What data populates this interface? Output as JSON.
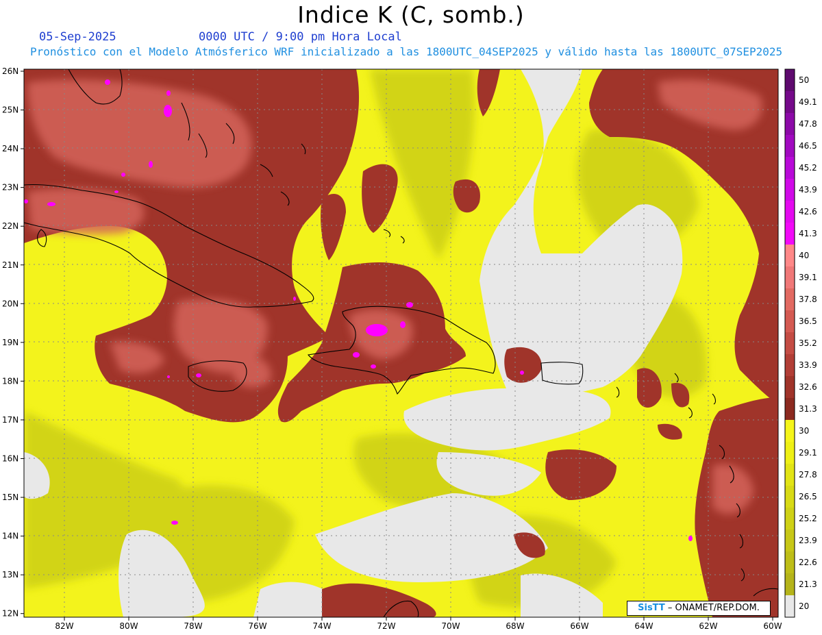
{
  "header": {
    "title": "Indice K (C, somb.)",
    "date": "05-Sep-2025",
    "time": "0000 UTC / 9:00 pm Hora Local",
    "forecast": "Pronóstico con el Modelo Atmósferico WRF inicializado a las 1800UTC_04SEP2025 y válido hasta las  1800UTC_07SEP2025"
  },
  "axes": {
    "lat_labels": [
      "26N",
      "25N",
      "24N",
      "23N",
      "22N",
      "21N",
      "20N",
      "19N",
      "18N",
      "17N",
      "16N",
      "15N",
      "14N",
      "13N",
      "12N"
    ],
    "lon_labels": [
      "82W",
      "80W",
      "78W",
      "76W",
      "74W",
      "72W",
      "70W",
      "68W",
      "66W",
      "64W",
      "62W",
      "60W"
    ]
  },
  "legend": {
    "levels": [
      "50",
      "49.1",
      "47.8",
      "46.5",
      "45.2",
      "43.9",
      "42.6",
      "41.3",
      "40",
      "39.1",
      "37.8",
      "36.5",
      "35.2",
      "33.9",
      "32.6",
      "31.3",
      "30",
      "29.1",
      "27.8",
      "26.5",
      "25.2",
      "23.9",
      "22.6",
      "21.3",
      "20"
    ],
    "colors": [
      "#5e0a6e",
      "#750a8a",
      "#8c0aa8",
      "#a10ac0",
      "#b80ad8",
      "#d00ae8",
      "#e40af0",
      "#f20af8",
      "#ff8888",
      "#f07878",
      "#e26a62",
      "#d45a52",
      "#c44c44",
      "#b23e36",
      "#a0342a",
      "#8c2a20",
      "#f5f51a",
      "#eef015",
      "#e2e415",
      "#d8da15",
      "#cfd116",
      "#c7c717",
      "#bebe18",
      "#b5b41a",
      "#e8e8e8"
    ]
  },
  "credit": {
    "logo": "SisTT",
    "text": " – ONAMET/REP.DOM."
  },
  "colors": {
    "low": "#e8e8e8",
    "yellow": "#f5f51a",
    "olive": "#cfd116",
    "brown": "#a0342a",
    "salmon": "#d4645a",
    "magenta": "#ff00ff",
    "subtitle_blue": "#1f3fd0",
    "subtitle_cyan": "#1f8fe0"
  }
}
